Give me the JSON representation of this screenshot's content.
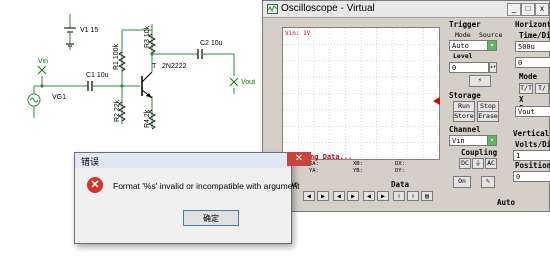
{
  "schematic": {
    "v1_label": "V1 15",
    "vin_label": "Vin",
    "vg1_label": "VG1",
    "c1_label": "C1 10u",
    "r1_label": "R1 100k",
    "r2_label": "R2 22k",
    "r3_label": "R3 10k",
    "r4_label": "R4 2k",
    "t_label": "T",
    "q_label": "2N2222",
    "c2_label": "C2 10u",
    "vout_label": "Vout"
  },
  "oscilloscope": {
    "title": "Oscilloscope - Virtual",
    "minimize": "_",
    "maximize": "□",
    "close": "x",
    "screen_channel_label": "Vin: 1V",
    "screen_status": "lecting Data...",
    "readouts": [
      "XA:",
      "YA:",
      "XB:",
      "YB:",
      "DX:",
      "DY:"
    ],
    "trigger": {
      "title": "Trigger",
      "mode_label": "Mode",
      "source_label": "Source",
      "mode_value": "Auto",
      "level_label": "Level",
      "level_value": "0"
    },
    "horizontal": {
      "title": "Horizonta",
      "time_div_label": "Time/Div",
      "time_div_value": "500u",
      "position_value": "0",
      "mode_label": "Mode",
      "mode_buttons": [
        "T/T",
        "T/"
      ],
      "x_source_label": "X Source",
      "x_source_value": "Vout"
    },
    "storage": {
      "title": "Storage",
      "buttons": [
        "Run",
        "Stop",
        "Store",
        "Erase"
      ]
    },
    "channel": {
      "title": "Channel",
      "value": "Vin",
      "coupling_label": "Coupling",
      "coupling_buttons": [
        "DC",
        "⏚",
        "AC"
      ],
      "on_label": "On"
    },
    "vertical": {
      "title": "Vertical",
      "volts_div_label": "Volts/Div",
      "volts_div_value": "1",
      "position_label": "Position",
      "position_value": "0"
    },
    "bottom": {
      "cursor_label": "or",
      "data_label": "Data",
      "auto_label": "Auto"
    }
  },
  "dialog": {
    "title": "错误",
    "close": "✕",
    "message": "Format '%s' invalid or incompatible with argument",
    "ok_label": "确定"
  },
  "colors": {
    "wire": "#2b8a3e",
    "probe": "#0a7a0a",
    "error": "#d9322a",
    "status_red": "#d20000"
  }
}
